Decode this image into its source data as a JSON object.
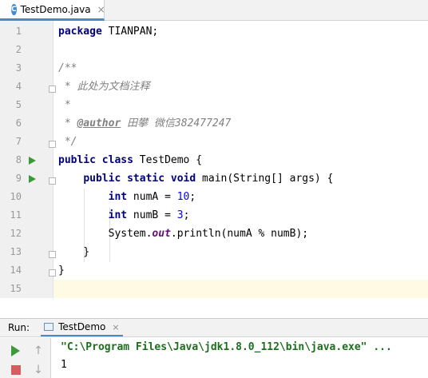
{
  "editor_tab": {
    "icon": "java-class-icon",
    "icon_glyph": "C",
    "title": "TestDemo.java",
    "close_glyph": "×"
  },
  "line_numbers": [
    "1",
    "2",
    "3",
    "4",
    "5",
    "6",
    "7",
    "8",
    "9",
    "10",
    "11",
    "12",
    "13",
    "14",
    "15"
  ],
  "code": {
    "l1": {
      "kw": "package",
      "rest": " TIANPAN;"
    },
    "l3": "/**",
    "l4": " * 此处为文档注释",
    "l5": " *",
    "l6": {
      "pre": " * ",
      "tag": "@author",
      "post": " 田攀 微信382477247"
    },
    "l7": " */",
    "l8": {
      "kw1": "public",
      "kw2": "class",
      "rest": " TestDemo {"
    },
    "l9": {
      "indent": "    ",
      "kw1": "public",
      "kw2": "static",
      "kw3": "void",
      "rest": " main(String[] args) {"
    },
    "l10": {
      "indent": "        ",
      "kw": "int",
      "mid": " numA = ",
      "num": "10",
      "end": ";"
    },
    "l11": {
      "indent": "        ",
      "kw": "int",
      "mid": " numB = ",
      "num": "3",
      "end": ";"
    },
    "l12": {
      "indent": "        ",
      "pre": "System.",
      "field": "out",
      "post": ".println(numA % numB);"
    },
    "l13": "    }",
    "l14": "}"
  },
  "run_panel": {
    "label": "Run:",
    "config_name": "TestDemo",
    "close_glyph": "×",
    "tools": {
      "rerun": "rerun-icon",
      "stop": "stop-icon",
      "up": "↑",
      "down": "↓"
    },
    "console": {
      "command": "\"C:\\Program Files\\Java\\jdk1.8.0_112\\bin\\java.exe\" ...",
      "output": "1"
    }
  },
  "colors": {
    "keyword": "#000080",
    "number": "#0000ff",
    "comment": "#808080",
    "static_field": "#660e7a",
    "run_green": "#3a9a3a",
    "console_command": "#1c6e1c",
    "current_line": "#fffae3",
    "tab_accent": "#4a88c7"
  }
}
